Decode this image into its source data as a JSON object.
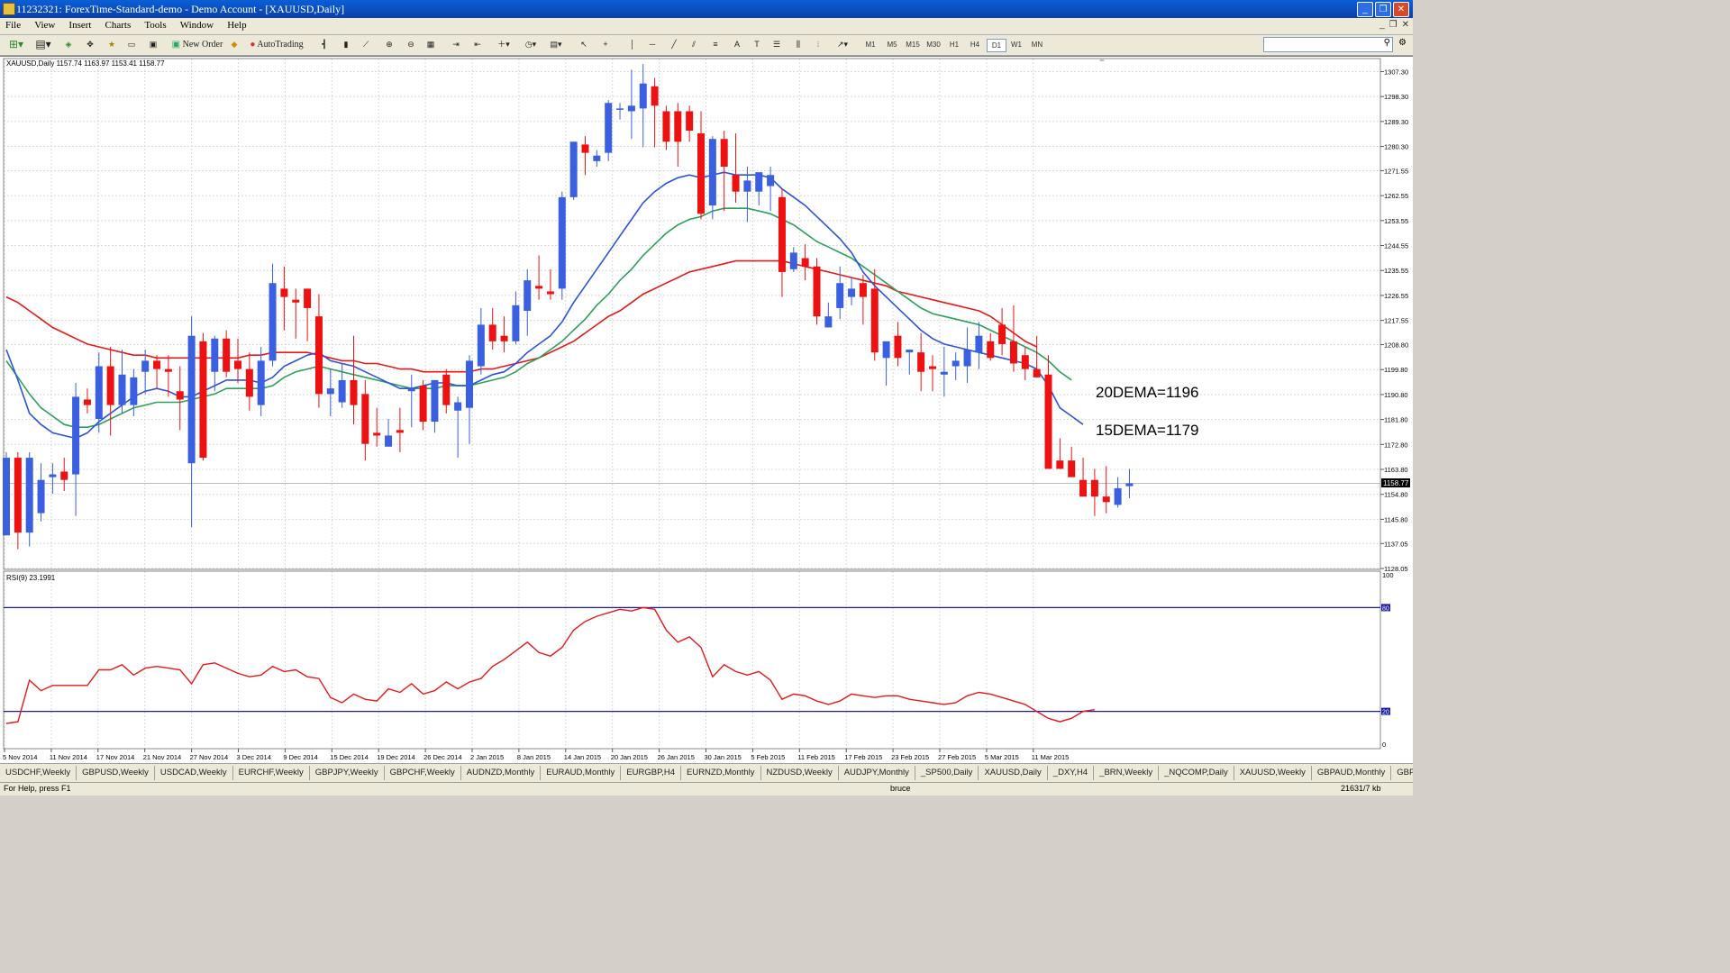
{
  "window": {
    "title": "11232321: ForexTime-Standard-demo - Demo Account - [XAUUSD,Daily]"
  },
  "menu": [
    "File",
    "View",
    "Insert",
    "Charts",
    "Tools",
    "Window",
    "Help"
  ],
  "toolbar": {
    "new_order": "New Order",
    "auto_trading": "AutoTrading",
    "timeframes": [
      "M1",
      "M5",
      "M15",
      "M30",
      "H1",
      "H4",
      "D1",
      "W1",
      "MN"
    ],
    "active_timeframe": "D1"
  },
  "chart": {
    "header": "XAUUSD,Daily  1157.74 1163.97 1153.41 1158.77",
    "rsi_label": "RSI(9) 23.1991",
    "annotation_20dema": "20DEMA=1196",
    "annotation_15dema": "15DEMA=1179",
    "current_price": "1158.77",
    "price_ticks": [
      "1307.30",
      "1298.30",
      "1289.30",
      "1280.30",
      "1271.55",
      "1262.55",
      "1253.55",
      "1244.55",
      "1235.55",
      "1226.55",
      "1217.55",
      "1208.80",
      "1199.80",
      "1190.80",
      "1181.80",
      "1172.80",
      "1163.80",
      "1154.80",
      "1145.80",
      "1137.05",
      "1128.05"
    ],
    "rsi_ticks": [
      "100",
      "80",
      "20",
      "0"
    ],
    "date_ticks": [
      "5 Nov 2014",
      "11 Nov 2014",
      "17 Nov 2014",
      "21 Nov 2014",
      "27 Nov 2014",
      "3 Dec 2014",
      "9 Dec 2014",
      "15 Dec 2014",
      "19 Dec 2014",
      "26 Dec 2014",
      "2 Jan 2015",
      "8 Jan 2015",
      "14 Jan 2015",
      "20 Jan 2015",
      "26 Jan 2015",
      "30 Jan 2015",
      "5 Feb 2015",
      "11 Feb 2015",
      "17 Feb 2015",
      "23 Feb 2015",
      "27 Feb 2015",
      "5 Mar 2015",
      "11 Mar 2015"
    ],
    "colors": {
      "bull": "#3a5fe0",
      "bear": "#ee1111",
      "ema_red": "#e61919",
      "ema_green": "#2ea05a",
      "ema_blue": "#2c53d8",
      "rsi_line": "#e61919",
      "rsi_levels": "#1a1aa8"
    }
  },
  "chart_data": {
    "type": "candlestick",
    "symbol": "XAUUSD",
    "timeframe": "Daily",
    "ylim": [
      1128.05,
      1312
    ],
    "candles": [
      {
        "o": 1140,
        "h": 1170,
        "l": 1140,
        "c": 1168
      },
      {
        "o": 1168,
        "h": 1170,
        "l": 1135,
        "c": 1141
      },
      {
        "o": 1141,
        "h": 1170,
        "l": 1136,
        "c": 1168
      },
      {
        "o": 1148,
        "h": 1166,
        "l": 1145,
        "c": 1160
      },
      {
        "o": 1161,
        "h": 1166,
        "l": 1155,
        "c": 1162
      },
      {
        "o": 1163,
        "h": 1168,
        "l": 1156,
        "c": 1160
      },
      {
        "o": 1162,
        "h": 1195,
        "l": 1147,
        "c": 1190
      },
      {
        "o": 1189,
        "h": 1193,
        "l": 1184,
        "c": 1187
      },
      {
        "o": 1182,
        "h": 1206,
        "l": 1177,
        "c": 1201
      },
      {
        "o": 1201,
        "h": 1208,
        "l": 1176,
        "c": 1187
      },
      {
        "o": 1187,
        "h": 1207,
        "l": 1184,
        "c": 1198
      },
      {
        "o": 1187,
        "h": 1200,
        "l": 1183,
        "c": 1197
      },
      {
        "o": 1199,
        "h": 1207,
        "l": 1191,
        "c": 1203
      },
      {
        "o": 1203,
        "h": 1205,
        "l": 1193,
        "c": 1200
      },
      {
        "o": 1200,
        "h": 1205,
        "l": 1190,
        "c": 1199
      },
      {
        "o": 1192,
        "h": 1201,
        "l": 1178,
        "c": 1189
      },
      {
        "o": 1166,
        "h": 1219,
        "l": 1143,
        "c": 1212
      },
      {
        "o": 1210,
        "h": 1213,
        "l": 1167,
        "c": 1168
      },
      {
        "o": 1199,
        "h": 1212,
        "l": 1192,
        "c": 1211
      },
      {
        "o": 1211,
        "h": 1214,
        "l": 1197,
        "c": 1199
      },
      {
        "o": 1203,
        "h": 1211,
        "l": 1195,
        "c": 1200
      },
      {
        "o": 1200,
        "h": 1206,
        "l": 1185,
        "c": 1190
      },
      {
        "o": 1187,
        "h": 1208,
        "l": 1183,
        "c": 1203
      },
      {
        "o": 1203,
        "h": 1238,
        "l": 1201,
        "c": 1231
      },
      {
        "o": 1229,
        "h": 1237,
        "l": 1214,
        "c": 1226
      },
      {
        "o": 1225,
        "h": 1229,
        "l": 1211,
        "c": 1224
      },
      {
        "o": 1229,
        "h": 1229,
        "l": 1210,
        "c": 1222
      },
      {
        "o": 1219,
        "h": 1227,
        "l": 1186,
        "c": 1191
      },
      {
        "o": 1191,
        "h": 1200,
        "l": 1183,
        "c": 1193
      },
      {
        "o": 1188,
        "h": 1202,
        "l": 1186,
        "c": 1196
      },
      {
        "o": 1196,
        "h": 1212,
        "l": 1180,
        "c": 1187
      },
      {
        "o": 1191,
        "h": 1196,
        "l": 1167,
        "c": 1173
      },
      {
        "o": 1177,
        "h": 1186,
        "l": 1172,
        "c": 1176
      },
      {
        "o": 1172,
        "h": 1182,
        "l": 1172,
        "c": 1176
      },
      {
        "o": 1178,
        "h": 1186,
        "l": 1170,
        "c": 1177
      },
      {
        "o": 1192,
        "h": 1198,
        "l": 1179,
        "c": 1193
      },
      {
        "o": 1194,
        "h": 1196,
        "l": 1178,
        "c": 1181
      },
      {
        "o": 1181,
        "h": 1194,
        "l": 1177,
        "c": 1196
      },
      {
        "o": 1198,
        "h": 1200,
        "l": 1184,
        "c": 1187
      },
      {
        "o": 1185,
        "h": 1190,
        "l": 1168,
        "c": 1188
      },
      {
        "o": 1186,
        "h": 1205,
        "l": 1173,
        "c": 1203
      },
      {
        "o": 1201,
        "h": 1222,
        "l": 1198,
        "c": 1216
      },
      {
        "o": 1216,
        "h": 1222,
        "l": 1207,
        "c": 1210
      },
      {
        "o": 1212,
        "h": 1219,
        "l": 1206,
        "c": 1210
      },
      {
        "o": 1210,
        "h": 1228,
        "l": 1209,
        "c": 1223
      },
      {
        "o": 1221,
        "h": 1236,
        "l": 1212,
        "c": 1232
      },
      {
        "o": 1230,
        "h": 1241,
        "l": 1225,
        "c": 1229
      },
      {
        "o": 1228,
        "h": 1236,
        "l": 1225,
        "c": 1227
      },
      {
        "o": 1229,
        "h": 1264,
        "l": 1225,
        "c": 1262
      },
      {
        "o": 1262,
        "h": 1282,
        "l": 1261,
        "c": 1282
      },
      {
        "o": 1281,
        "h": 1284,
        "l": 1270,
        "c": 1278
      },
      {
        "o": 1275,
        "h": 1279,
        "l": 1273,
        "c": 1277
      },
      {
        "o": 1278,
        "h": 1297,
        "l": 1275,
        "c": 1296
      },
      {
        "o": 1294,
        "h": 1296,
        "l": 1290,
        "c": 1294
      },
      {
        "o": 1293,
        "h": 1308,
        "l": 1283,
        "c": 1295
      },
      {
        "o": 1294,
        "h": 1310,
        "l": 1280,
        "c": 1303
      },
      {
        "o": 1302,
        "h": 1305,
        "l": 1280,
        "c": 1295
      },
      {
        "o": 1293,
        "h": 1295,
        "l": 1279,
        "c": 1282
      },
      {
        "o": 1293,
        "h": 1296,
        "l": 1273,
        "c": 1282
      },
      {
        "o": 1293,
        "h": 1295,
        "l": 1282,
        "c": 1286
      },
      {
        "o": 1285,
        "h": 1293,
        "l": 1254,
        "c": 1256
      },
      {
        "o": 1259,
        "h": 1284,
        "l": 1254,
        "c": 1283
      },
      {
        "o": 1283,
        "h": 1286,
        "l": 1257,
        "c": 1273
      },
      {
        "o": 1270,
        "h": 1285,
        "l": 1260,
        "c": 1264
      },
      {
        "o": 1264,
        "h": 1273,
        "l": 1253,
        "c": 1268
      },
      {
        "o": 1264,
        "h": 1270,
        "l": 1259,
        "c": 1271
      },
      {
        "o": 1266,
        "h": 1273,
        "l": 1257,
        "c": 1270
      },
      {
        "o": 1262,
        "h": 1265,
        "l": 1226,
        "c": 1235
      },
      {
        "o": 1236,
        "h": 1244,
        "l": 1235,
        "c": 1242
      },
      {
        "o": 1240,
        "h": 1245,
        "l": 1232,
        "c": 1237
      },
      {
        "o": 1237,
        "h": 1240,
        "l": 1216,
        "c": 1219
      },
      {
        "o": 1215,
        "h": 1224,
        "l": 1215,
        "c": 1219
      },
      {
        "o": 1222,
        "h": 1237,
        "l": 1218,
        "c": 1231
      },
      {
        "o": 1226,
        "h": 1233,
        "l": 1223,
        "c": 1229
      },
      {
        "o": 1231,
        "h": 1234,
        "l": 1216,
        "c": 1226
      },
      {
        "o": 1229,
        "h": 1236,
        "l": 1203,
        "c": 1206
      },
      {
        "o": 1204,
        "h": 1209,
        "l": 1194,
        "c": 1210
      },
      {
        "o": 1212,
        "h": 1217,
        "l": 1201,
        "c": 1204
      },
      {
        "o": 1206,
        "h": 1207,
        "l": 1198,
        "c": 1207
      },
      {
        "o": 1206,
        "h": 1213,
        "l": 1192,
        "c": 1199
      },
      {
        "o": 1201,
        "h": 1205,
        "l": 1192,
        "c": 1200
      },
      {
        "o": 1198,
        "h": 1208,
        "l": 1190,
        "c": 1199
      },
      {
        "o": 1201,
        "h": 1206,
        "l": 1196,
        "c": 1203
      },
      {
        "o": 1201,
        "h": 1215,
        "l": 1195,
        "c": 1207
      },
      {
        "o": 1206,
        "h": 1217,
        "l": 1200,
        "c": 1212
      },
      {
        "o": 1210,
        "h": 1213,
        "l": 1203,
        "c": 1204
      },
      {
        "o": 1216,
        "h": 1222,
        "l": 1205,
        "c": 1209
      },
      {
        "o": 1210,
        "h": 1223,
        "l": 1199,
        "c": 1202
      },
      {
        "o": 1205,
        "h": 1208,
        "l": 1196,
        "c": 1200
      },
      {
        "o": 1200,
        "h": 1212,
        "l": 1197,
        "c": 1197
      },
      {
        "o": 1198,
        "h": 1205,
        "l": 1164,
        "c": 1164
      },
      {
        "o": 1167,
        "h": 1175,
        "l": 1164,
        "c": 1164
      },
      {
        "o": 1167,
        "h": 1172,
        "l": 1162,
        "c": 1161
      },
      {
        "o": 1160,
        "h": 1168,
        "l": 1157,
        "c": 1154
      },
      {
        "o": 1160,
        "h": 1164,
        "l": 1147,
        "c": 1154
      },
      {
        "o": 1154,
        "h": 1165,
        "l": 1148,
        "c": 1152
      },
      {
        "o": 1151,
        "h": 1161,
        "l": 1150,
        "c": 1157
      },
      {
        "o": 1157.74,
        "h": 1163.97,
        "l": 1153.41,
        "c": 1158.77
      }
    ],
    "ema_blue_15": [
      1207,
      1196,
      1184,
      1180,
      1177,
      1176,
      1175,
      1177,
      1181,
      1184,
      1187,
      1190,
      1192,
      1193,
      1192,
      1190,
      1190,
      1192,
      1194,
      1196,
      1196,
      1196,
      1195,
      1197,
      1201,
      1203,
      1205,
      1206,
      1203,
      1202,
      1201,
      1199,
      1197,
      1195,
      1193,
      1193,
      1194,
      1195,
      1195,
      1194,
      1194,
      1196,
      1198,
      1199,
      1202,
      1206,
      1209,
      1212,
      1217,
      1224,
      1230,
      1236,
      1242,
      1248,
      1254,
      1260,
      1264,
      1267,
      1269,
      1270,
      1269,
      1270,
      1271,
      1270,
      1270,
      1270,
      1269,
      1265,
      1262,
      1259,
      1255,
      1251,
      1247,
      1242,
      1235,
      1230,
      1226,
      1222,
      1218,
      1214,
      1211,
      1209,
      1208,
      1207,
      1206,
      1205,
      1204,
      1203,
      1202,
      1200,
      1194,
      1186,
      1183,
      1180
    ],
    "ema_green_20": [
      1203,
      1197,
      1191,
      1186,
      1183,
      1180,
      1179,
      1179,
      1180,
      1182,
      1184,
      1186,
      1187,
      1188,
      1188,
      1188,
      1189,
      1190,
      1191,
      1193,
      1193,
      1193,
      1193,
      1194,
      1197,
      1199,
      1200,
      1201,
      1200,
      1199,
      1198,
      1197,
      1196,
      1195,
      1194,
      1193,
      1193,
      1193,
      1194,
      1194,
      1194,
      1195,
      1196,
      1197,
      1199,
      1202,
      1204,
      1207,
      1210,
      1214,
      1218,
      1223,
      1227,
      1232,
      1236,
      1241,
      1245,
      1249,
      1252,
      1254,
      1255,
      1257,
      1258,
      1258,
      1258,
      1257,
      1256,
      1254,
      1252,
      1249,
      1246,
      1244,
      1242,
      1240,
      1237,
      1234,
      1231,
      1228,
      1225,
      1222,
      1220,
      1219,
      1218,
      1217,
      1216,
      1214,
      1212,
      1210,
      1208,
      1206,
      1203,
      1199,
      1196
    ],
    "ema_red_long": [
      1226,
      1224,
      1221,
      1218,
      1215,
      1213,
      1211,
      1209,
      1208,
      1207,
      1206,
      1205,
      1205,
      1204,
      1204,
      1204,
      1204,
      1204,
      1204,
      1204,
      1204,
      1205,
      1205,
      1206,
      1206,
      1206,
      1206,
      1205,
      1204,
      1203,
      1203,
      1202,
      1202,
      1201,
      1200,
      1200,
      1199,
      1199,
      1199,
      1199,
      1199,
      1200,
      1200,
      1201,
      1202,
      1203,
      1204,
      1206,
      1208,
      1210,
      1213,
      1216,
      1219,
      1221,
      1224,
      1227,
      1229,
      1231,
      1233,
      1235,
      1236,
      1237,
      1238,
      1239,
      1239,
      1239,
      1239,
      1239,
      1238,
      1237,
      1236,
      1235,
      1234,
      1233,
      1232,
      1231,
      1230,
      1228,
      1227,
      1226,
      1225,
      1224,
      1223,
      1222,
      1221,
      1219,
      1216,
      1213,
      1210,
      1208
    ],
    "rsi": [
      13,
      14,
      38,
      32,
      35,
      35,
      35,
      35,
      44,
      44,
      47,
      41,
      45,
      46,
      45,
      44,
      36,
      47,
      48,
      45,
      42,
      40,
      41,
      46,
      43,
      44,
      40,
      39,
      28,
      25,
      30,
      27,
      26,
      33,
      31,
      36,
      30,
      32,
      37,
      33,
      37,
      39,
      46,
      50,
      55,
      60,
      54,
      52,
      57,
      67,
      72,
      75,
      77,
      79,
      78,
      80,
      79,
      67,
      60,
      63,
      57,
      40,
      47,
      43,
      41,
      43,
      38,
      27,
      30,
      29,
      26,
      24,
      26,
      30,
      29,
      28,
      29,
      29,
      27,
      26,
      25,
      24,
      25,
      29,
      31,
      30,
      28,
      26,
      24,
      20,
      16,
      14,
      16,
      20,
      21
    ]
  },
  "tabs": [
    "USDCHF,Weekly",
    "GBPUSD,Weekly",
    "USDCAD,Weekly",
    "EURCHF,Weekly",
    "GBPJPY,Weekly",
    "GBPCHF,Weekly",
    "AUDNZD,Monthly",
    "EURAUD,Monthly",
    "EURGBP,H4",
    "EURNZD,Monthly",
    "NZDUSD,Weekly",
    "AUDJPY,Monthly",
    "_SP500,Daily",
    "XAUUSD,Daily",
    "_DXY,H4",
    "_BRN,Weekly",
    "_NQCOMP,Daily",
    "XAUUSD,Weekly",
    "GBPAUD,Monthly",
    "GBPCAD,I"
  ],
  "status": {
    "help": "For Help, press F1",
    "profile": "bruce",
    "traffic": "21631/7 kb"
  }
}
